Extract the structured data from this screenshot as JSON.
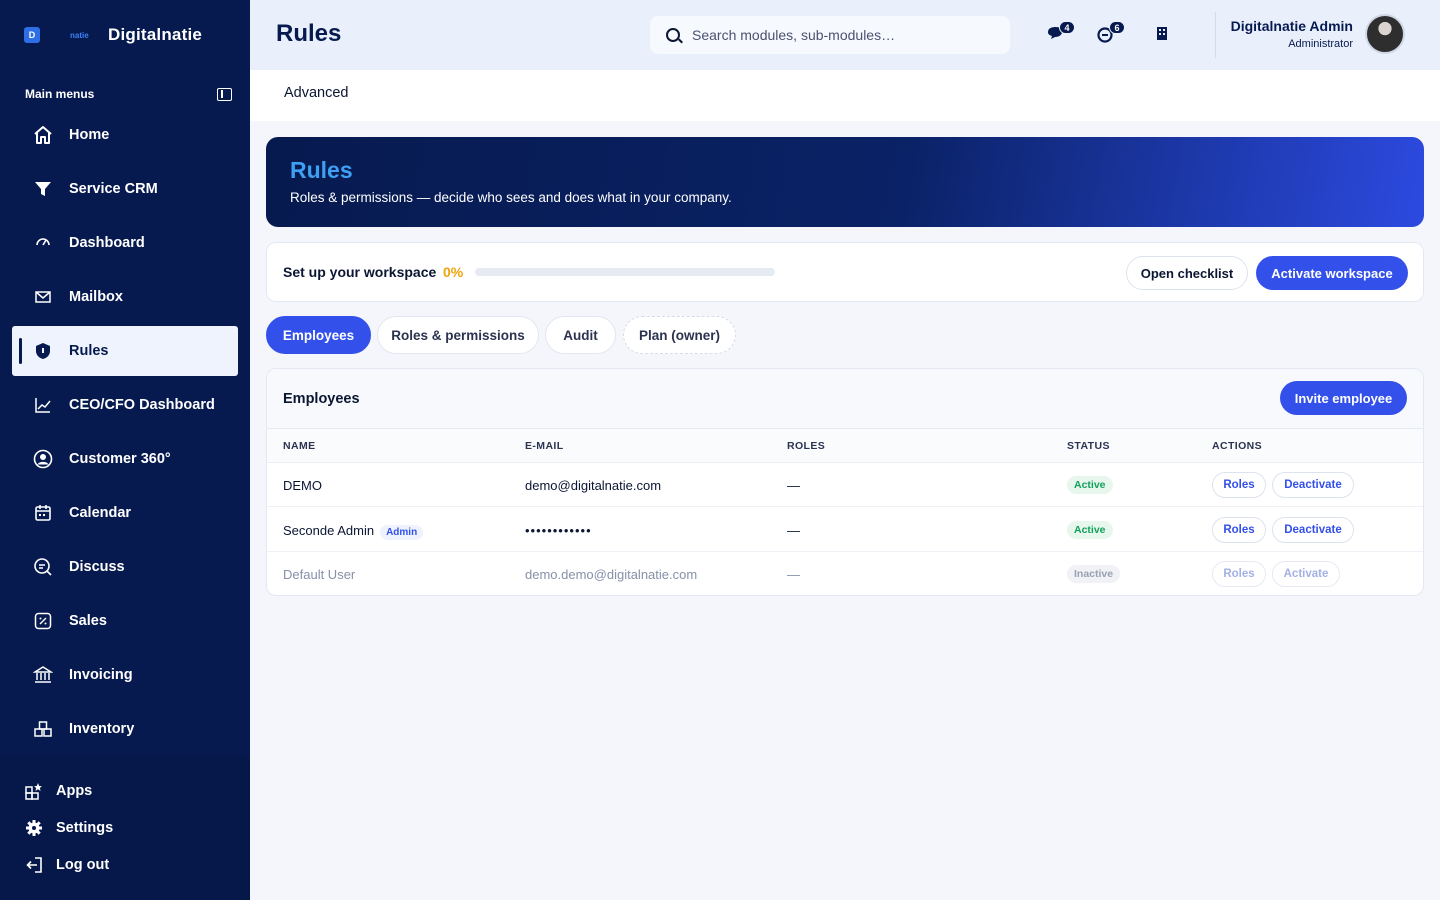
{
  "brand": {
    "logo_letter": "D",
    "logo_small": "natie",
    "name": "Digitalnatie"
  },
  "sidebar": {
    "heading": "Main menus",
    "items": [
      {
        "label": "Home",
        "icon": "home-icon"
      },
      {
        "label": "Service CRM",
        "icon": "filter-icon"
      },
      {
        "label": "Dashboard",
        "icon": "gauge-icon"
      },
      {
        "label": "Mailbox",
        "icon": "mail-icon"
      },
      {
        "label": "Rules",
        "icon": "shield-icon",
        "active": true
      },
      {
        "label": "CEO/CFO Dashboard",
        "icon": "chart-line-icon"
      },
      {
        "label": "Customer 360°",
        "icon": "user-circle-icon"
      },
      {
        "label": "Calendar",
        "icon": "calendar-icon"
      },
      {
        "label": "Discuss",
        "icon": "chat-icon"
      },
      {
        "label": "Sales",
        "icon": "percent-icon"
      },
      {
        "label": "Invoicing",
        "icon": "bank-icon"
      },
      {
        "label": "Inventory",
        "icon": "boxes-icon"
      }
    ],
    "bottom": [
      {
        "label": "Apps",
        "icon": "apps-icon"
      },
      {
        "label": "Settings",
        "icon": "gear-icon"
      },
      {
        "label": "Log out",
        "icon": "logout-icon"
      }
    ]
  },
  "topbar": {
    "title": "Rules",
    "search_placeholder": "Search modules, sub-modules…",
    "messages_badge": "4",
    "notifications_badge": "6",
    "user_name": "Digitalnatie Admin",
    "user_role": "Administrator"
  },
  "subnav": {
    "tab": "Advanced"
  },
  "hero": {
    "title": "Rules",
    "subtitle": "Roles & permissions — decide who sees and does what in your company."
  },
  "setup": {
    "label": "Set up your workspace",
    "percent_text": "0%",
    "progress": 0,
    "open_checklist": "Open checklist",
    "activate": "Activate workspace"
  },
  "tabs": [
    "Employees",
    "Roles & permissions",
    "Audit",
    "Plan (owner)"
  ],
  "employees": {
    "title": "Employees",
    "invite": "Invite employee",
    "columns": [
      "NAME",
      "E-MAIL",
      "ROLES",
      "STATUS",
      "ACTIONS"
    ],
    "rows": [
      {
        "name": "DEMO",
        "tag": "",
        "email": "demo@digitalnatie.com",
        "roles": "—",
        "status": "Active",
        "act1": "Roles",
        "act2": "Deactivate"
      },
      {
        "name": "Seconde Admin",
        "tag": "Admin",
        "email": "••••••••••••",
        "roles": "—",
        "status": "Active",
        "act1": "Roles",
        "act2": "Deactivate"
      },
      {
        "name": "Default User",
        "tag": "",
        "email": "demo.demo@digitalnatie.com",
        "roles": "—",
        "status": "Inactive",
        "act1": "Roles",
        "act2": "Activate"
      }
    ]
  },
  "colors": {
    "navy": "#071a4f",
    "primary": "#3350ea",
    "accent": "#3ea0f5",
    "warning": "#f0a30a",
    "success": "#12a15a"
  }
}
